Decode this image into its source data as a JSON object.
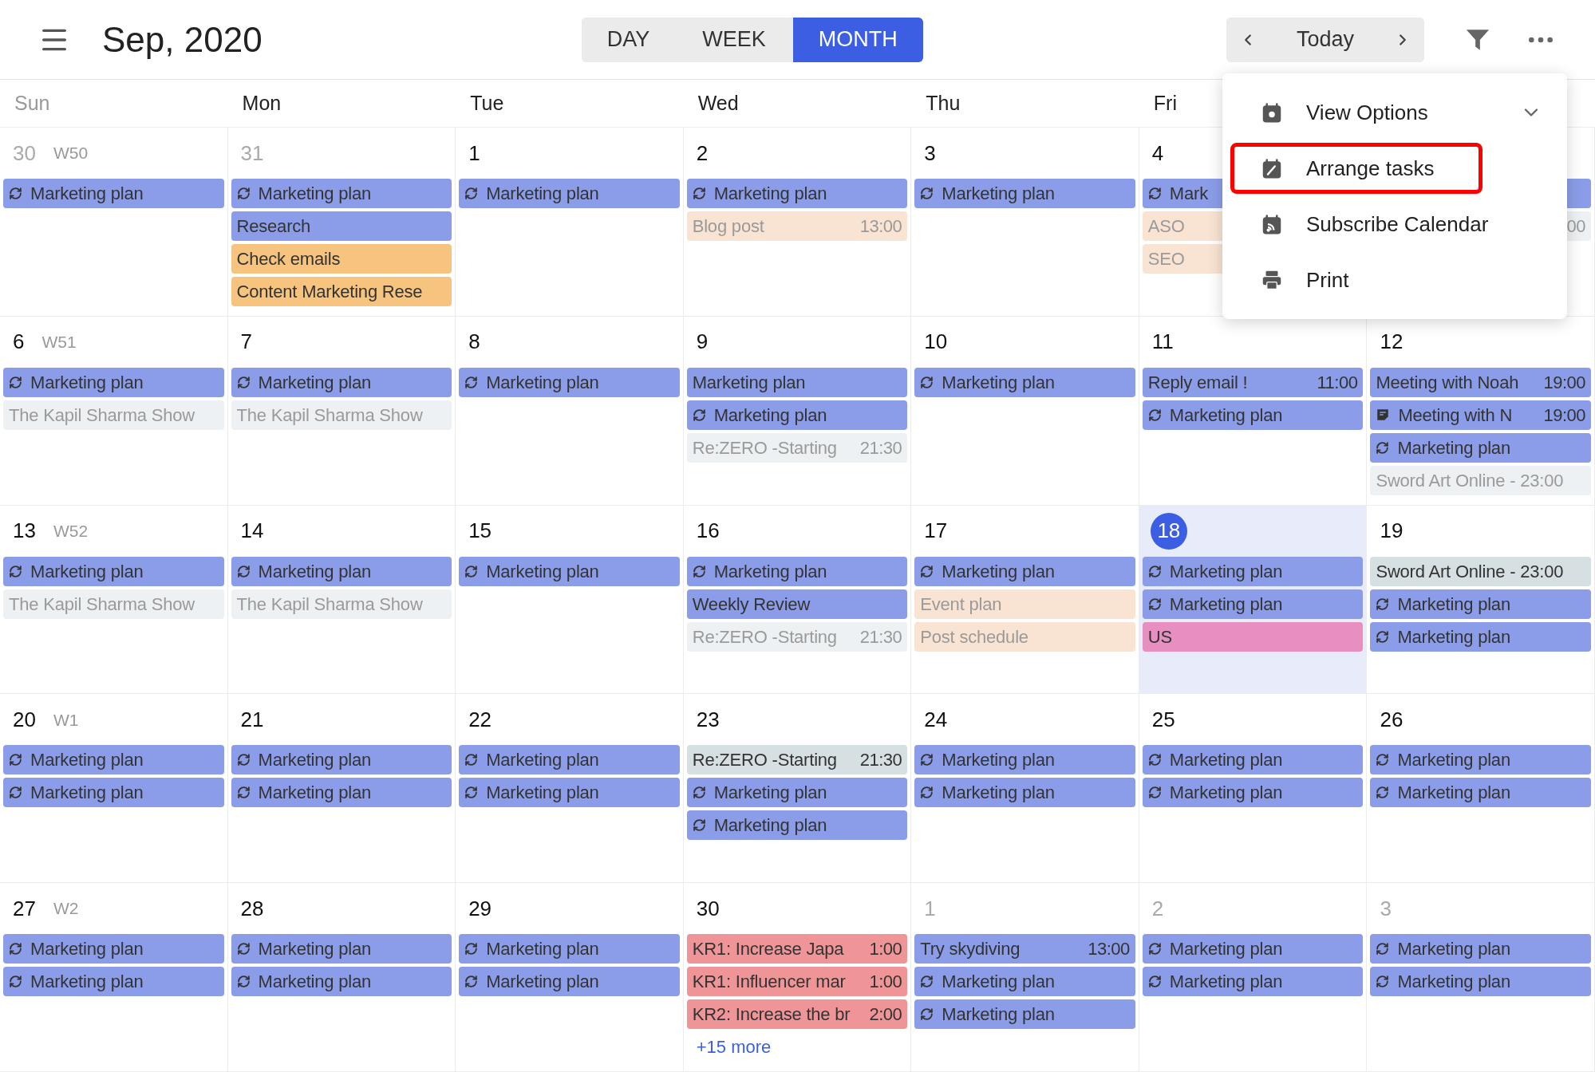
{
  "header": {
    "title": "Sep, 2020",
    "views": [
      {
        "label": "DAY",
        "selected": false
      },
      {
        "label": "WEEK",
        "selected": false
      },
      {
        "label": "MONTH",
        "selected": true
      }
    ],
    "today_button": "Today"
  },
  "weekdays": [
    {
      "label": "Sun",
      "muted": true
    },
    {
      "label": "Mon",
      "muted": false
    },
    {
      "label": "Tue",
      "muted": false
    },
    {
      "label": "Wed",
      "muted": false
    },
    {
      "label": "Thu",
      "muted": false
    },
    {
      "label": "Fri",
      "muted": false
    }
  ],
  "weeks": [
    {
      "label": "W50",
      "days": [
        {
          "day": "30",
          "other_month": true,
          "today": false,
          "events": [
            {
              "kind": "repeat",
              "title": "Marketing plan",
              "color": "#8b9de8",
              "muted": false
            }
          ]
        },
        {
          "day": "31",
          "other_month": true,
          "today": false,
          "events": [
            {
              "kind": "repeat",
              "title": "Marketing plan",
              "color": "#8b9de8",
              "muted": false
            },
            {
              "kind": "plain",
              "title": "Research",
              "color": "#8b9de8",
              "muted": false
            },
            {
              "kind": "plain",
              "title": "Check emails",
              "color": "#f6c47f",
              "muted": false
            },
            {
              "kind": "plain",
              "title": "Content Marketing Rese",
              "color": "#f6c47f",
              "muted": false
            }
          ]
        },
        {
          "day": "1",
          "other_month": false,
          "today": false,
          "events": [
            {
              "kind": "repeat",
              "title": "Marketing plan",
              "color": "#8b9de8",
              "muted": false
            }
          ]
        },
        {
          "day": "2",
          "other_month": false,
          "today": false,
          "events": [
            {
              "kind": "repeat",
              "title": "Marketing plan",
              "color": "#8b9de8",
              "muted": false
            },
            {
              "kind": "plain",
              "title": "Blog post",
              "time": "13:00",
              "color": "#f9e4d3",
              "muted": true
            }
          ]
        },
        {
          "day": "3",
          "other_month": false,
          "today": false,
          "events": [
            {
              "kind": "repeat",
              "title": "Marketing plan",
              "color": "#8b9de8",
              "muted": false
            }
          ]
        },
        {
          "day": "4",
          "other_month": false,
          "today": false,
          "events": [
            {
              "kind": "repeat",
              "title": "Mark",
              "color": "#8b9de8",
              "muted": false
            },
            {
              "kind": "plain",
              "title": "ASO",
              "color": "#f9e4d3",
              "muted": true
            },
            {
              "kind": "plain",
              "title": "SEO",
              "color": "#f9e4d3",
              "muted": true
            }
          ]
        },
        {
          "events": [
            {
              "kind": "plain",
              "color": "#8b9de8"
            },
            {
              "kind": "plain",
              "time": "00",
              "color": "#edf1f3",
              "muted": true
            }
          ]
        }
      ]
    },
    {
      "label": "W51",
      "days": [
        {
          "day": "6",
          "other_month": false,
          "today": false,
          "events": [
            {
              "kind": "repeat",
              "title": "Marketing plan",
              "color": "#8b9de8",
              "muted": false
            },
            {
              "kind": "plain",
              "title": "The Kapil Sharma Show",
              "color": "#edf1f3",
              "muted": true
            }
          ]
        },
        {
          "day": "7",
          "other_month": false,
          "today": false,
          "events": [
            {
              "kind": "repeat",
              "title": "Marketing plan",
              "color": "#8b9de8",
              "muted": false
            },
            {
              "kind": "plain",
              "title": "The Kapil Sharma Show",
              "color": "#edf1f3",
              "muted": true
            }
          ]
        },
        {
          "day": "8",
          "other_month": false,
          "today": false,
          "events": [
            {
              "kind": "repeat",
              "title": "Marketing plan",
              "color": "#8b9de8",
              "muted": false
            }
          ]
        },
        {
          "day": "9",
          "other_month": false,
          "today": false,
          "events": [
            {
              "kind": "plain",
              "title": "Marketing plan",
              "color": "#8b9de8",
              "muted": false
            },
            {
              "kind": "repeat",
              "title": "Marketing plan",
              "color": "#8b9de8",
              "muted": false
            },
            {
              "kind": "plain",
              "title": "Re:ZERO -Starting",
              "time": "21:30",
              "color": "#edf1f3",
              "muted": true
            }
          ]
        },
        {
          "day": "10",
          "other_month": false,
          "today": false,
          "events": [
            {
              "kind": "repeat",
              "title": "Marketing plan",
              "color": "#8b9de8",
              "muted": false
            }
          ]
        },
        {
          "day": "11",
          "other_month": false,
          "today": false,
          "events": [
            {
              "kind": "plain",
              "title": "Reply email !",
              "time": "11:00",
              "color": "#8b9de8",
              "muted": false
            },
            {
              "kind": "repeat",
              "title": "Marketing plan",
              "color": "#8b9de8",
              "muted": false
            }
          ]
        },
        {
          "day": "12",
          "other_month": false,
          "today": false,
          "events": [
            {
              "kind": "plain",
              "title": "Meeting with Noah",
              "time": "19:00",
              "color": "#8b9de8",
              "muted": false
            },
            {
              "kind": "note",
              "title": "Meeting with N",
              "time": "19:00",
              "color": "#8b9de8",
              "muted": false
            },
            {
              "kind": "repeat",
              "title": "Marketing plan",
              "color": "#8b9de8",
              "muted": false
            },
            {
              "kind": "plain",
              "title": "Sword Art Online - 23:00",
              "color": "#edf1f3",
              "muted": true
            }
          ]
        }
      ]
    },
    {
      "label": "W52",
      "days": [
        {
          "day": "13",
          "other_month": false,
          "today": false,
          "events": [
            {
              "kind": "repeat",
              "title": "Marketing plan",
              "color": "#8b9de8",
              "muted": false
            },
            {
              "kind": "plain",
              "title": "The Kapil Sharma Show",
              "color": "#edf1f3",
              "muted": true
            }
          ]
        },
        {
          "day": "14",
          "other_month": false,
          "today": false,
          "events": [
            {
              "kind": "repeat",
              "title": "Marketing plan",
              "color": "#8b9de8",
              "muted": false
            },
            {
              "kind": "plain",
              "title": "The Kapil Sharma Show",
              "color": "#edf1f3",
              "muted": true
            }
          ]
        },
        {
          "day": "15",
          "other_month": false,
          "today": false,
          "events": [
            {
              "kind": "repeat",
              "title": "Marketing plan",
              "color": "#8b9de8",
              "muted": false
            }
          ]
        },
        {
          "day": "16",
          "other_month": false,
          "today": false,
          "events": [
            {
              "kind": "repeat",
              "title": "Marketing plan",
              "color": "#8b9de8",
              "muted": false
            },
            {
              "kind": "plain",
              "title": "Weekly Review",
              "color": "#8b9de8",
              "muted": false
            },
            {
              "kind": "plain",
              "title": "Re:ZERO -Starting",
              "time": "21:30",
              "color": "#edf1f3",
              "muted": true
            }
          ]
        },
        {
          "day": "17",
          "other_month": false,
          "today": false,
          "events": [
            {
              "kind": "repeat",
              "title": "Marketing plan",
              "color": "#8b9de8",
              "muted": false
            },
            {
              "kind": "plain",
              "title": "Event plan",
              "color": "#f9e4d3",
              "muted": true
            },
            {
              "kind": "plain",
              "title": "Post schedule",
              "color": "#f9e4d3",
              "muted": true
            }
          ]
        },
        {
          "day": "18",
          "other_month": false,
          "today": true,
          "events": [
            {
              "kind": "repeat",
              "title": "Marketing plan",
              "color": "#8b9de8",
              "muted": false
            },
            {
              "kind": "repeat",
              "title": "Marketing plan",
              "color": "#8b9de8",
              "muted": false
            },
            {
              "kind": "plain",
              "title": "US",
              "color": "#e88fc1",
              "muted": false
            }
          ]
        },
        {
          "day": "19",
          "other_month": false,
          "today": false,
          "events": [
            {
              "kind": "plain",
              "title": "Sword Art Online - 23:00",
              "color": "#d6dfe2",
              "muted": false
            },
            {
              "kind": "repeat",
              "title": "Marketing plan",
              "color": "#8b9de8",
              "muted": false
            },
            {
              "kind": "repeat",
              "title": "Marketing plan",
              "color": "#8b9de8",
              "muted": false
            }
          ]
        }
      ]
    },
    {
      "label": "W1",
      "days": [
        {
          "day": "20",
          "other_month": false,
          "today": false,
          "events": [
            {
              "kind": "repeat",
              "title": "Marketing plan",
              "color": "#8b9de8",
              "muted": false
            },
            {
              "kind": "repeat",
              "title": "Marketing plan",
              "color": "#8b9de8",
              "muted": false
            }
          ]
        },
        {
          "day": "21",
          "other_month": false,
          "today": false,
          "events": [
            {
              "kind": "repeat",
              "title": "Marketing plan",
              "color": "#8b9de8",
              "muted": false
            },
            {
              "kind": "repeat",
              "title": "Marketing plan",
              "color": "#8b9de8",
              "muted": false
            }
          ]
        },
        {
          "day": "22",
          "other_month": false,
          "today": false,
          "events": [
            {
              "kind": "repeat",
              "title": "Marketing plan",
              "color": "#8b9de8",
              "muted": false
            },
            {
              "kind": "repeat",
              "title": "Marketing plan",
              "color": "#8b9de8",
              "muted": false
            }
          ]
        },
        {
          "day": "23",
          "other_month": false,
          "today": false,
          "events": [
            {
              "kind": "plain",
              "title": "Re:ZERO -Starting",
              "time": "21:30",
              "color": "#d6dfe2",
              "muted": false
            },
            {
              "kind": "repeat",
              "title": "Marketing plan",
              "color": "#8b9de8",
              "muted": false
            },
            {
              "kind": "repeat",
              "title": "Marketing plan",
              "color": "#8b9de8",
              "muted": false
            }
          ]
        },
        {
          "day": "24",
          "other_month": false,
          "today": false,
          "events": [
            {
              "kind": "repeat",
              "title": "Marketing plan",
              "color": "#8b9de8",
              "muted": false
            },
            {
              "kind": "repeat",
              "title": "Marketing plan",
              "color": "#8b9de8",
              "muted": false
            }
          ]
        },
        {
          "day": "25",
          "other_month": false,
          "today": false,
          "events": [
            {
              "kind": "repeat",
              "title": "Marketing plan",
              "color": "#8b9de8",
              "muted": false
            },
            {
              "kind": "repeat",
              "title": "Marketing plan",
              "color": "#8b9de8",
              "muted": false
            }
          ]
        },
        {
          "day": "26",
          "other_month": false,
          "today": false,
          "events": [
            {
              "kind": "repeat",
              "title": "Marketing plan",
              "color": "#8b9de8",
              "muted": false
            },
            {
              "kind": "repeat",
              "title": "Marketing plan",
              "color": "#8b9de8",
              "muted": false
            }
          ]
        }
      ]
    },
    {
      "label": "W2",
      "days": [
        {
          "day": "27",
          "other_month": false,
          "today": false,
          "events": [
            {
              "kind": "repeat",
              "title": "Marketing plan",
              "color": "#8b9de8",
              "muted": false
            },
            {
              "kind": "repeat",
              "title": "Marketing plan",
              "color": "#8b9de8",
              "muted": false
            }
          ]
        },
        {
          "day": "28",
          "other_month": false,
          "today": false,
          "events": [
            {
              "kind": "repeat",
              "title": "Marketing plan",
              "color": "#8b9de8",
              "muted": false
            },
            {
              "kind": "repeat",
              "title": "Marketing plan",
              "color": "#8b9de8",
              "muted": false
            }
          ]
        },
        {
          "day": "29",
          "other_month": false,
          "today": false,
          "events": [
            {
              "kind": "repeat",
              "title": "Marketing plan",
              "color": "#8b9de8",
              "muted": false
            },
            {
              "kind": "repeat",
              "title": "Marketing plan",
              "color": "#8b9de8",
              "muted": false
            }
          ]
        },
        {
          "day": "30",
          "other_month": false,
          "today": false,
          "more": "+15 more",
          "events": [
            {
              "kind": "plain",
              "title": "KR1: Increase Japa",
              "time": "1:00",
              "color": "#ef9598",
              "muted": false
            },
            {
              "kind": "plain",
              "title": "KR1: Influencer mar",
              "time": "1:00",
              "color": "#ef9598",
              "muted": false
            },
            {
              "kind": "plain",
              "title": "KR2: Increase the br",
              "time": "2:00",
              "color": "#ef9598",
              "muted": false
            }
          ]
        },
        {
          "day": "1",
          "other_month": true,
          "today": false,
          "events": [
            {
              "kind": "plain",
              "title": "Try skydiving",
              "time": "13:00",
              "color": "#8b9de8",
              "muted": false
            },
            {
              "kind": "repeat",
              "title": "Marketing plan",
              "color": "#8b9de8",
              "muted": false
            },
            {
              "kind": "repeat",
              "title": "Marketing plan",
              "color": "#8b9de8",
              "muted": false
            }
          ]
        },
        {
          "day": "2",
          "other_month": true,
          "today": false,
          "events": [
            {
              "kind": "repeat",
              "title": "Marketing plan",
              "color": "#8b9de8",
              "muted": false
            },
            {
              "kind": "repeat",
              "title": "Marketing plan",
              "color": "#8b9de8",
              "muted": false
            }
          ]
        },
        {
          "day": "3",
          "other_month": true,
          "today": false,
          "events": [
            {
              "kind": "repeat",
              "title": "Marketing plan",
              "color": "#8b9de8",
              "muted": false
            },
            {
              "kind": "repeat",
              "title": "Marketing plan",
              "color": "#8b9de8",
              "muted": false
            }
          ]
        }
      ]
    }
  ],
  "menu": {
    "items": [
      {
        "kind": "view",
        "label": "View Options",
        "expandable": true,
        "annotated": false
      },
      {
        "kind": "arrange",
        "label": "Arrange tasks",
        "expandable": false,
        "annotated": true
      },
      {
        "kind": "subscribe",
        "label": "Subscribe Calendar",
        "expandable": false,
        "annotated": false
      },
      {
        "kind": "print",
        "label": "Print",
        "expandable": false,
        "annotated": false
      }
    ]
  }
}
